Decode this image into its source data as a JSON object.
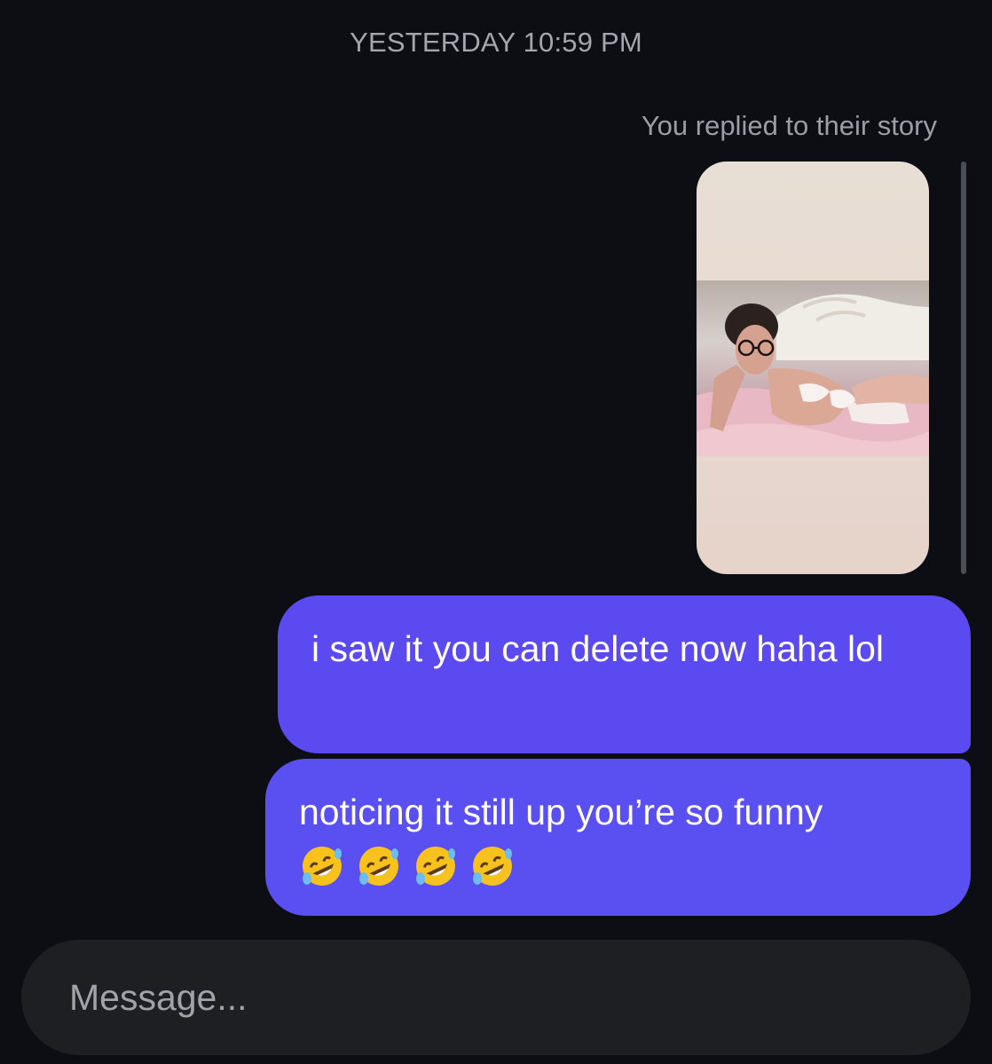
{
  "conversation": {
    "timestamp": "YESTERDAY 10:59 PM",
    "story_reply_label": "You replied to their story"
  },
  "story_card": {
    "icon": "story-thumbnail"
  },
  "messages": [
    {
      "text": "i saw it you can delete now haha lol"
    },
    {
      "text": "noticing it still up you’re so funny",
      "emoji_count": 4,
      "emoji": "rolling-on-floor-laughing"
    }
  ],
  "composer": {
    "placeholder": "Message..."
  },
  "colors": {
    "background": "#0c0e13",
    "bubble": "#5a4cf1",
    "composer": "#1d1f22",
    "muted_text": "#a3a6ad"
  }
}
